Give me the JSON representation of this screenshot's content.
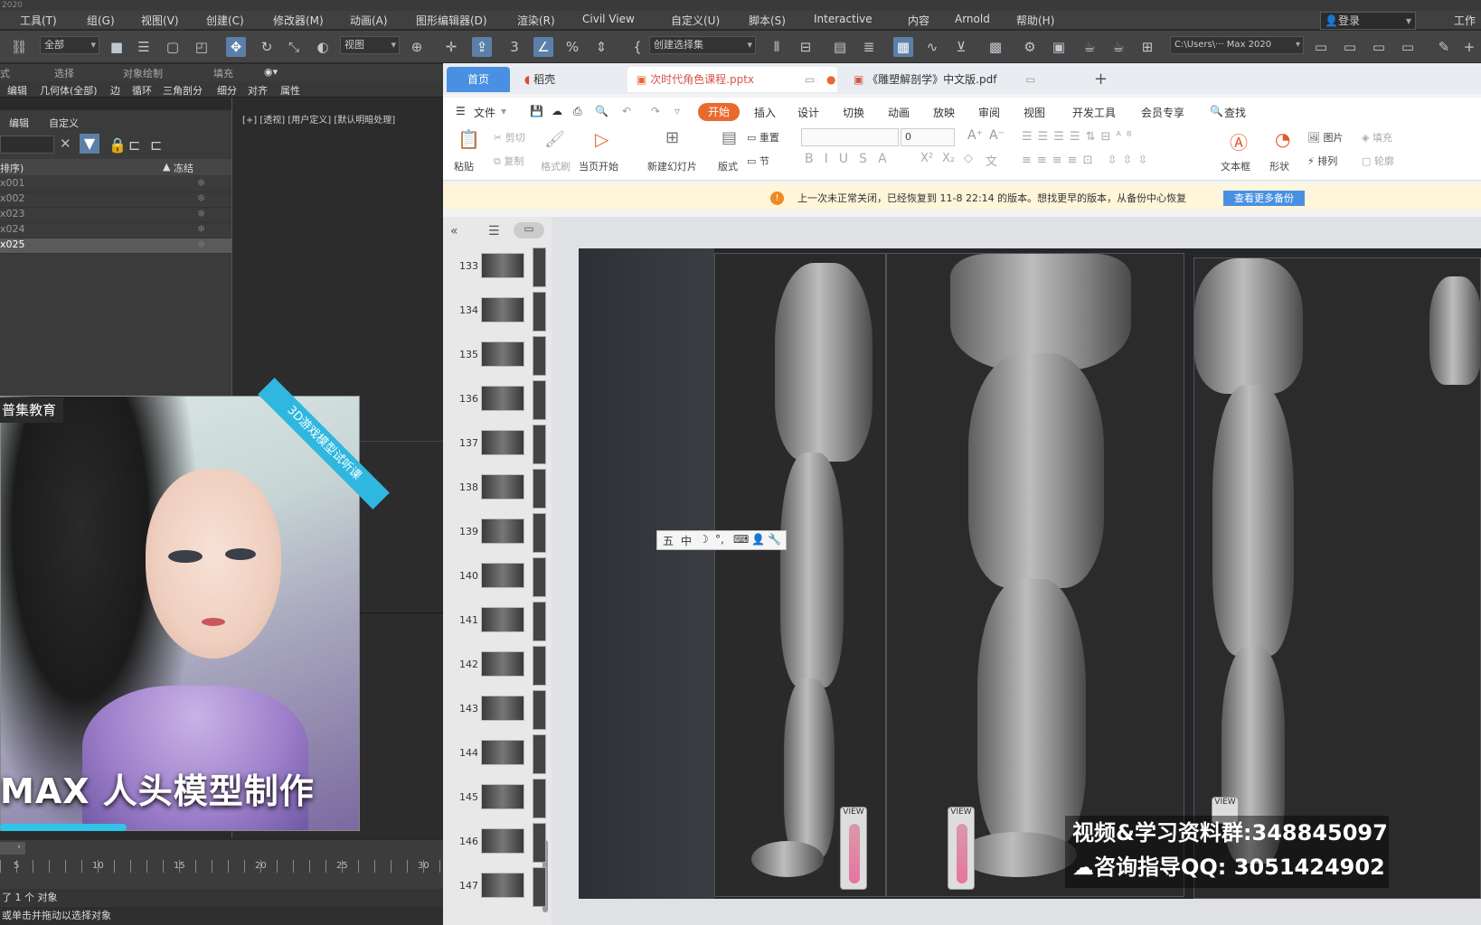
{
  "app": {
    "title_fragment": "2020"
  },
  "menubar": {
    "items": [
      "工具(T)",
      "组(G)",
      "视图(V)",
      "创建(C)",
      "修改器(M)",
      "动画(A)",
      "图形编辑器(D)",
      "渲染(R)",
      "Civil View",
      "自定义(U)",
      "脚本(S)",
      "Interactive",
      "内容",
      "Arnold",
      "帮助(H)"
    ],
    "login": "登录",
    "workspace": "工作"
  },
  "toolbar": {
    "filter_all": "全部",
    "view_dropdown": "视图",
    "selection_set": "创建选择集",
    "path": "C:\\Users\\··· Max 2020"
  },
  "ribbon": {
    "row1": [
      "式",
      "选择",
      "对象绘制",
      "填充"
    ],
    "row2": [
      "编辑",
      "几何体(全部)",
      "边",
      "循环",
      "三角剖分",
      "细分",
      "对齐",
      "属性"
    ]
  },
  "scene_explorer": {
    "tabs": [
      "编辑",
      "自定义"
    ],
    "col_name": "排序)",
    "col_freeze": "冻结",
    "rows": [
      "x001",
      "x002",
      "x023",
      "x024",
      "x025"
    ],
    "selected_index": 4
  },
  "viewport": {
    "label": "[+] [透视] [用户定义] [默认明暗处理]"
  },
  "ad": {
    "badge": "普集教育",
    "ribbon": "3D游戏模型试听课",
    "title": "MAX 人头模型制作"
  },
  "timeline": {
    "ticks": [
      "5",
      "10",
      "15",
      "20",
      "25",
      "30"
    ]
  },
  "status": {
    "line1": "了 1 个 对象",
    "line2": "或单击并拖动以选择对象"
  },
  "wps": {
    "tabs": [
      "首页",
      "稻壳",
      "次时代角色课程.pptx",
      "《雕塑解剖学》中文版.pdf",
      "+"
    ],
    "menu": [
      "文件",
      "开始",
      "插入",
      "设计",
      "切换",
      "动画",
      "放映",
      "审阅",
      "视图",
      "开发工具",
      "会员专享",
      "查找"
    ],
    "ribbon": {
      "paste": "粘贴",
      "cut": "剪切",
      "copy": "复制",
      "format_painter": "格式刷",
      "from_current": "当页开始",
      "new_slide": "新建幻灯片",
      "layout": "版式",
      "reset": "重置",
      "section": "节",
      "font_size": "0",
      "textbox": "文本框",
      "shape": "形状",
      "picture": "图片",
      "arrange": "排列",
      "fill": "填充",
      "outline": "轮廓"
    },
    "notice": "上一次未正常关闭，已经恢复到 11-8 22:14 的版本。想找更早的版本，从备份中心恢复",
    "notice_button": "查看更多备份",
    "slide_numbers": [
      "133",
      "134",
      "135",
      "136",
      "137",
      "138",
      "139",
      "140",
      "141",
      "142",
      "143",
      "144",
      "145",
      "146",
      "147"
    ],
    "view_label": "VIEW"
  },
  "ime": {
    "items": [
      "五",
      "中",
      "☽",
      "°,",
      "⌨",
      "👤",
      "🔧"
    ]
  },
  "overlay": {
    "line1": "视频&学习资料群:348845097",
    "line2": "咨询指导QQ: 3051424902"
  }
}
